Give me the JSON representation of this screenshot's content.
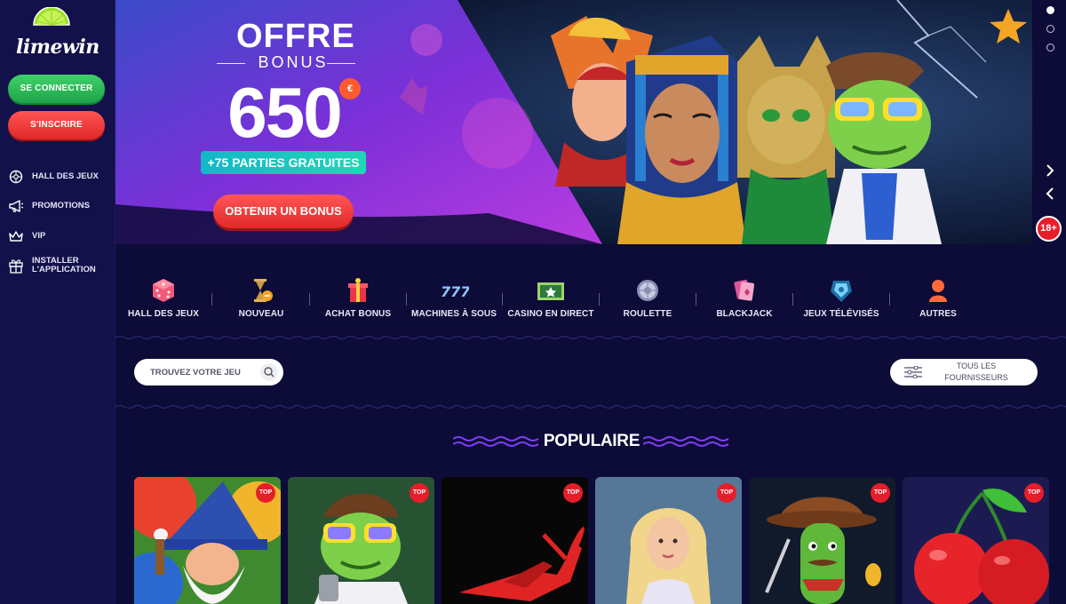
{
  "sidebar": {
    "logo_text": "limewin",
    "login_label": "SE CONNECTER",
    "signup_label": "S'INSCRIRE",
    "items": [
      {
        "label": "HALL DES JEUX"
      },
      {
        "label": "PROMOTIONS"
      },
      {
        "label": "VIP"
      },
      {
        "label": "INSTALLER L'APPLICATION"
      }
    ]
  },
  "banner": {
    "title": "OFFRE",
    "subtitle": "BONUS",
    "amount": "650",
    "currency": "€",
    "free_spins": "+75 PARTIES GRATUITES",
    "cta_label": "OBTENIR UN BONUS",
    "age_limit": "18+",
    "slides_total": 3,
    "active_slide": 1
  },
  "categories": [
    {
      "label": "HALL DES JEUX",
      "icon": "dice-icon"
    },
    {
      "label": "NOUVEAU",
      "icon": "hourglass-icon"
    },
    {
      "label": "ACHAT BONUS",
      "icon": "gift-icon"
    },
    {
      "label": "MACHINES À SOUS",
      "icon": "slots-777-icon"
    },
    {
      "label": "CASINO EN DIRECT",
      "icon": "live-table-icon"
    },
    {
      "label": "ROULETTE",
      "icon": "roulette-icon"
    },
    {
      "label": "BLACKJACK",
      "icon": "cards-icon"
    },
    {
      "label": "JEUX TÉLÉVISÉS",
      "icon": "tv-show-icon"
    },
    {
      "label": "AUTRES",
      "icon": "person-icon"
    }
  ],
  "search": {
    "placeholder": "TROUVEZ VOTRE JEU"
  },
  "providers": {
    "label": "TOUS LES FOURNISSEURS"
  },
  "section": {
    "title": "POPULAIRE"
  },
  "games": [
    {
      "badge": "TOP",
      "art": "wizard-art"
    },
    {
      "badge": "TOP",
      "art": "frog-art"
    },
    {
      "badge": "TOP",
      "art": "aviator-plane-art"
    },
    {
      "badge": "TOP",
      "art": "goddess-art"
    },
    {
      "badge": "TOP",
      "art": "cactus-cowboy-art"
    },
    {
      "badge": "TOP",
      "art": "cherries-art"
    }
  ],
  "colors": {
    "background": "#0d0b37",
    "sidebar": "#13114a",
    "green": "#2fbf5c",
    "red": "#e61e2a",
    "teal": "#1ec4c0"
  }
}
